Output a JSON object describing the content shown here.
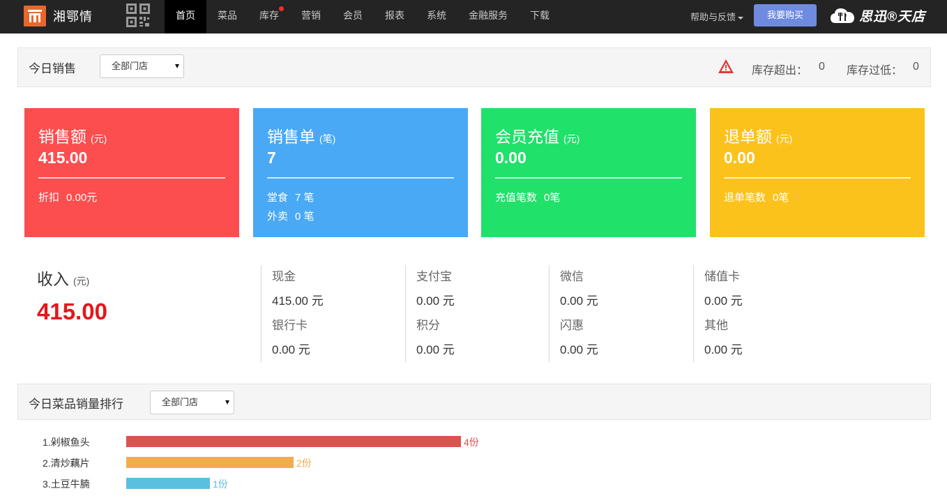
{
  "nav": {
    "brand_name": "湘鄂情",
    "items": [
      {
        "label": "首页",
        "active": true
      },
      {
        "label": "菜品"
      },
      {
        "label": "库存",
        "dot": true
      },
      {
        "label": "营销"
      },
      {
        "label": "会员"
      },
      {
        "label": "报表"
      },
      {
        "label": "系统"
      },
      {
        "label": "金融服务"
      },
      {
        "label": "下载"
      }
    ],
    "help_label": "帮助与反馈",
    "buy_label": "我要购买",
    "logo_right_text": "思迅®天店"
  },
  "sales_panel": {
    "title": "今日销售",
    "store_select": "全部门店",
    "stock_over_label": "库存超出：",
    "stock_over_value": "0",
    "stock_low_label": "库存过低：",
    "stock_low_value": "0"
  },
  "cards": [
    {
      "title": "销售额",
      "unit": "(元)",
      "value": "415.00",
      "color": "#fc4d4f",
      "subs": [
        {
          "label": "折扣",
          "value": "0.00元"
        }
      ]
    },
    {
      "title": "销售单",
      "unit": "(笔)",
      "value": "7",
      "color": "#49a9f4",
      "subs": [
        {
          "label": "堂食",
          "value": "7 笔"
        },
        {
          "label": "外卖",
          "value": "0 笔"
        }
      ]
    },
    {
      "title": "会员充值",
      "unit": "(元)",
      "value": "0.00",
      "color": "#20e16a",
      "subs": [
        {
          "label": "充值笔数",
          "value": "0笔"
        }
      ]
    },
    {
      "title": "退单额",
      "unit": "(元)",
      "value": "0.00",
      "color": "#fbc21c",
      "subs": [
        {
          "label": "退单笔数",
          "value": "0笔"
        }
      ]
    }
  ],
  "income": {
    "title": "收入",
    "unit": "(元)",
    "total": "415.00",
    "columns": [
      [
        {
          "label": "现金",
          "value": "415.00 元"
        },
        {
          "label": "银行卡",
          "value": "0.00 元"
        }
      ],
      [
        {
          "label": "支付宝",
          "value": "0.00 元"
        },
        {
          "label": "积分",
          "value": "0.00 元"
        }
      ],
      [
        {
          "label": "微信",
          "value": "0.00 元"
        },
        {
          "label": "闪惠",
          "value": "0.00 元"
        }
      ],
      [
        {
          "label": "储值卡",
          "value": "0.00 元"
        },
        {
          "label": "其他",
          "value": "0.00 元"
        }
      ]
    ]
  },
  "ranking_panel": {
    "title": "今日菜品销量排行",
    "store_select": "全部门店"
  },
  "ranking": [
    {
      "label": "1.剁椒鱼头",
      "count": 4,
      "count_text": "4份",
      "color": "#d9534f"
    },
    {
      "label": "2.清炒藕片",
      "count": 2,
      "count_text": "2份",
      "color": "#f0ad4e"
    },
    {
      "label": "3.土豆牛腩",
      "count": 1,
      "count_text": "1份",
      "color": "#5bc0de"
    }
  ]
}
